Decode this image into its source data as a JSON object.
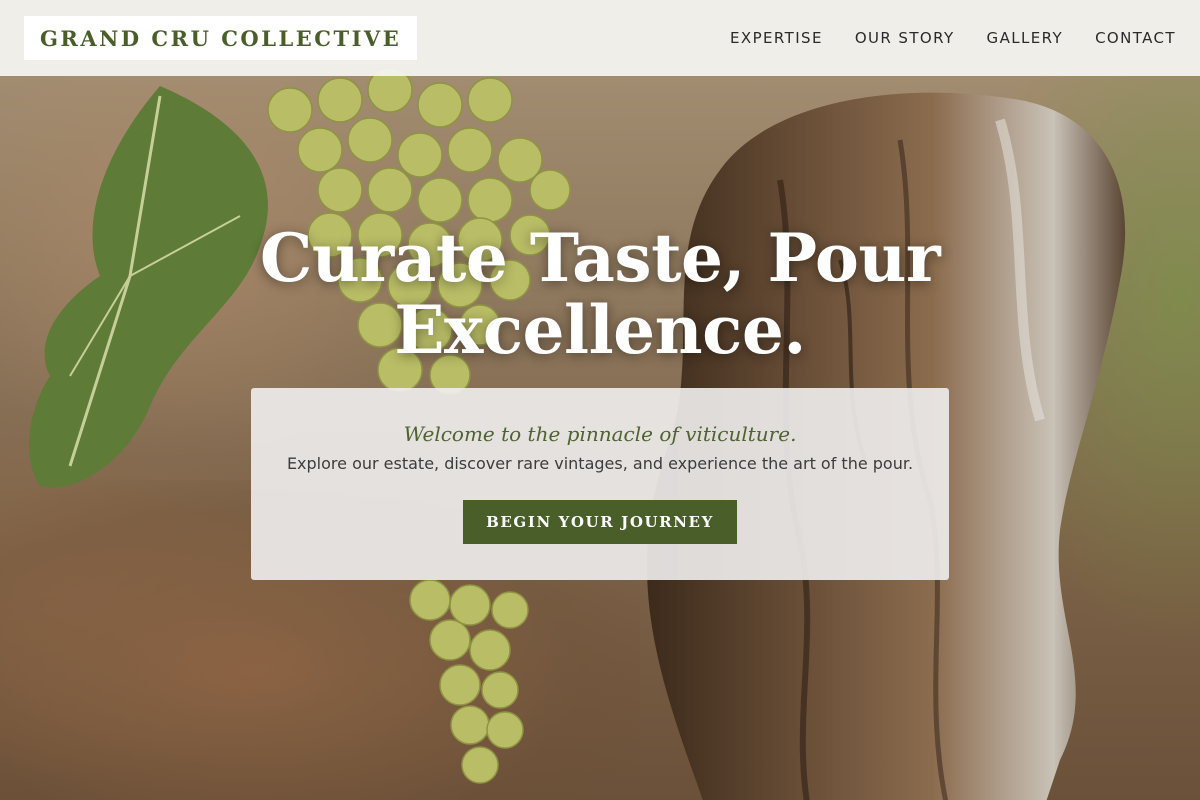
{
  "brand": {
    "name": "GRAND CRU COLLECTIVE"
  },
  "nav": {
    "items": [
      {
        "label": "EXPERTISE"
      },
      {
        "label": "OUR STORY"
      },
      {
        "label": "GALLERY"
      },
      {
        "label": "CONTACT"
      }
    ]
  },
  "hero": {
    "title_line1": "Curate Taste, Pour",
    "title_line2": "Excellence.",
    "tagline": "Welcome to the pinnacle of viticulture.",
    "intro": "Explore our estate, discover rare vintages, and experience the art of the pour.",
    "cta_label": "BEGIN YOUR JOURNEY"
  },
  "colors": {
    "brand_green": "#4a5e2a",
    "nav_bg": "#f5f5f2",
    "card_bg": "#f0eeee"
  }
}
